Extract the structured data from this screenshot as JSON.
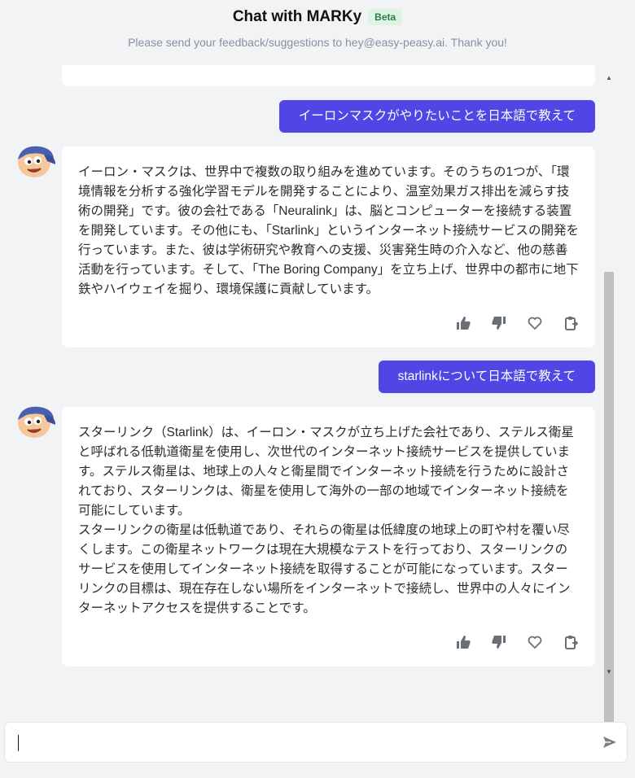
{
  "header": {
    "title": "Chat with MARKy",
    "badge": "Beta",
    "subtitle": "Please send your feedback/suggestions to hey@easy-peasy.ai. Thank you!"
  },
  "messages": [
    {
      "role": "user",
      "text": "イーロンマスクがやりたいことを日本語で教えて"
    },
    {
      "role": "bot",
      "avatar_icon": "marky-avatar-icon",
      "text": "イーロン・マスクは、世界中で複数の取り組みを進めています。そのうちの1つが、「環境情報を分析する強化学習モデルを開発することにより、温室効果ガス排出を減らす技術の開発」です。彼の会社である「Neuralink」は、脳とコンピューターを接続する装置を開発しています。その他にも、「Starlink」というインターネット接続サービスの開発を行っています。また、彼は学術研究や教育への支援、災害発生時の介入など、他の慈善活動を行っています。そして、「The Boring Company」を立ち上げ、世界中の都市に地下鉄やハイウェイを掘り、環境保護に貢献しています。",
      "actions": [
        "thumbs-up-icon",
        "thumbs-down-icon",
        "heart-icon",
        "copy-icon"
      ]
    },
    {
      "role": "user",
      "text": "starlinkについて日本語で教えて"
    },
    {
      "role": "bot",
      "avatar_icon": "marky-avatar-icon",
      "text": "スターリンク（Starlink）は、イーロン・マスクが立ち上げた会社であり、ステルス衛星と呼ばれる低軌道衛星を使用し、次世代のインターネット接続サービスを提供しています。ステルス衛星は、地球上の人々と衛星間でインターネット接続を行うために設計されており、スターリンクは、衛星を使用して海外の一部の地域でインターネット接続を可能にしています。\nスターリンクの衛星は低軌道であり、それらの衛星は低緯度の地球上の町や村を覆い尽くします。この衛星ネットワークは現在大規模なテストを行っており、スターリンクのサービスを使用してインターネット接続を取得することが可能になっています。スターリンクの目標は、現在存在しない場所をインターネットで接続し、世界中の人々にインターネットアクセスを提供することです。",
      "actions": [
        "thumbs-up-icon",
        "thumbs-down-icon",
        "heart-icon",
        "copy-icon"
      ]
    }
  ],
  "composer": {
    "value": "",
    "placeholder": "",
    "send_icon": "send-icon"
  },
  "colors": {
    "accent": "#4f46e5",
    "background": "#f2f3f5",
    "badge_bg": "#dcf5e3",
    "badge_text": "#2f7a4a"
  }
}
